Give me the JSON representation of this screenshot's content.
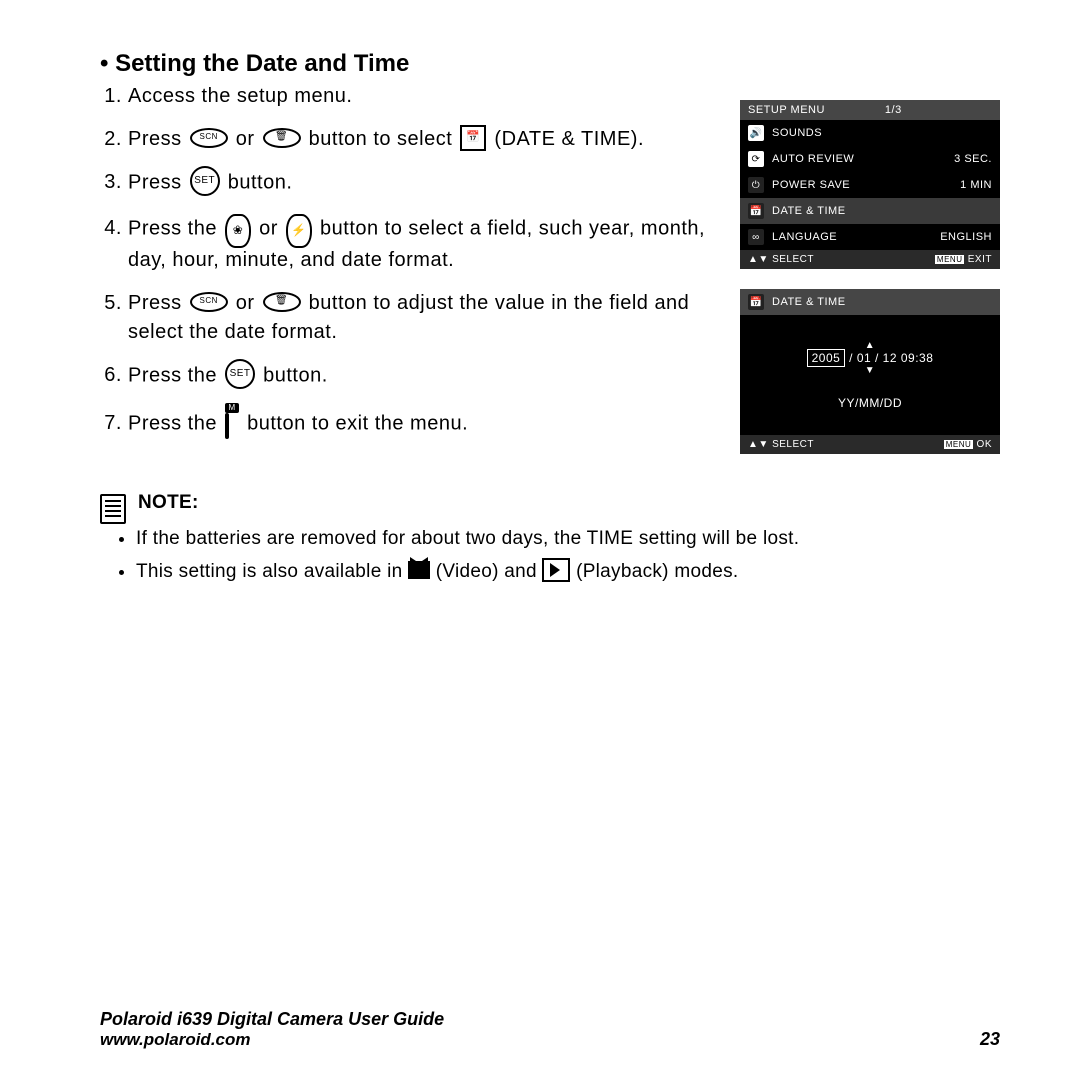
{
  "heading": "• Setting the Date and Time",
  "steps": {
    "s1": "Access the setup menu.",
    "s2a": "Press ",
    "s2b": " or ",
    "s2c": " button to select ",
    "s2d": " (DATE & TIME).",
    "s3a": "Press ",
    "s3b": " button.",
    "s4a": "Press the ",
    "s4b": " or ",
    "s4c": " button to select a field, such year, month, day, hour, minute, and date format.",
    "s5a": "Press ",
    "s5b": " or ",
    "s5c": " button to adjust the value in the field and select the date format.",
    "s6a": "Press  the ",
    "s6b": " button.",
    "s7a": "Press the ",
    "s7b": " button to exit the menu."
  },
  "note": {
    "title": "NOTE:",
    "n1": "If the batteries are removed for about two days, the TIME setting will be lost.",
    "n2a": "This setting is also available in ",
    "n2b": " (Video) and ",
    "n2c": " (Playback) modes."
  },
  "lcd1": {
    "title": "SETUP MENU",
    "page": "1/3",
    "r1": "SOUNDS",
    "r2": "AUTO REVIEW",
    "r2v": "3 SEC.",
    "r3": "POWER SAVE",
    "r3v": "1 MIN",
    "r4": "DATE & TIME",
    "r5": "LANGUAGE",
    "r5v": "ENGLISH",
    "fL": "SELECT",
    "fR": "EXIT",
    "fRtag": "MENU"
  },
  "lcd2": {
    "title": "DATE & TIME",
    "year": "2005",
    "rest": " / 01 / 12  09:38",
    "fmt": "YY/MM/DD",
    "fL": "SELECT",
    "fR": "OK",
    "fRtag": "MENU"
  },
  "footer": {
    "guide": "Polaroid i639 Digital Camera User Guide",
    "url": "www.polaroid.com",
    "page": "23"
  }
}
